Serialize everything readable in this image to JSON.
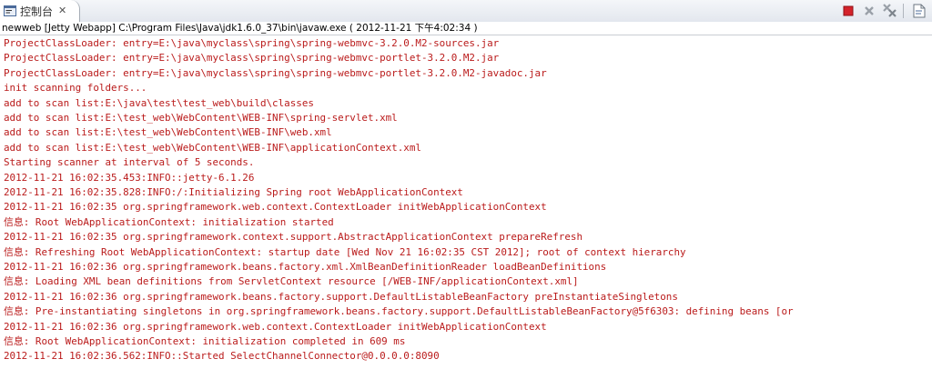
{
  "tab": {
    "label": "控制台",
    "icon": "console-icon",
    "close": "✕"
  },
  "toolbar": {
    "buttons": [
      "terminate-icon",
      "remove-launch-icon",
      "remove-all-terminated-icon",
      "new-console-icon"
    ]
  },
  "description": "newweb [Jetty Webapp] C:\\Program Files\\Java\\jdk1.6.0_37\\bin\\javaw.exe ( 2012-11-21 下午4:02:34 )",
  "console": {
    "text_color": "#ba1b1b",
    "lines": [
      "ProjectClassLoader: entry=E:\\java\\myclass\\spring\\spring-webmvc-3.2.0.M2-sources.jar",
      "ProjectClassLoader: entry=E:\\java\\myclass\\spring\\spring-webmvc-portlet-3.2.0.M2.jar",
      "ProjectClassLoader: entry=E:\\java\\myclass\\spring\\spring-webmvc-portlet-3.2.0.M2-javadoc.jar",
      "init scanning folders...",
      "add to scan list:E:\\java\\test\\test_web\\build\\classes",
      "add to scan list:E:\\test_web\\WebContent\\WEB-INF\\spring-servlet.xml",
      "add to scan list:E:\\test_web\\WebContent\\WEB-INF\\web.xml",
      "add to scan list:E:\\test_web\\WebContent\\WEB-INF\\applicationContext.xml",
      "Starting scanner at interval of 5 seconds.",
      "2012-11-21 16:02:35.453:INFO::jetty-6.1.26",
      "2012-11-21 16:02:35.828:INFO:/:Initializing Spring root WebApplicationContext",
      "2012-11-21 16:02:35 org.springframework.web.context.ContextLoader initWebApplicationContext",
      "信息: Root WebApplicationContext: initialization started",
      "2012-11-21 16:02:35 org.springframework.context.support.AbstractApplicationContext prepareRefresh",
      "信息: Refreshing Root WebApplicationContext: startup date [Wed Nov 21 16:02:35 CST 2012]; root of context hierarchy",
      "2012-11-21 16:02:36 org.springframework.beans.factory.xml.XmlBeanDefinitionReader loadBeanDefinitions",
      "信息: Loading XML bean definitions from ServletContext resource [/WEB-INF/applicationContext.xml]",
      "2012-11-21 16:02:36 org.springframework.beans.factory.support.DefaultListableBeanFactory preInstantiateSingletons",
      "信息: Pre-instantiating singletons in org.springframework.beans.factory.support.DefaultListableBeanFactory@5f6303: defining beans [or",
      "2012-11-21 16:02:36 org.springframework.web.context.ContextLoader initWebApplicationContext",
      "信息: Root WebApplicationContext: initialization completed in 609 ms",
      "2012-11-21 16:02:36.562:INFO::Started SelectChannelConnector@0.0.0.0:8090"
    ]
  }
}
